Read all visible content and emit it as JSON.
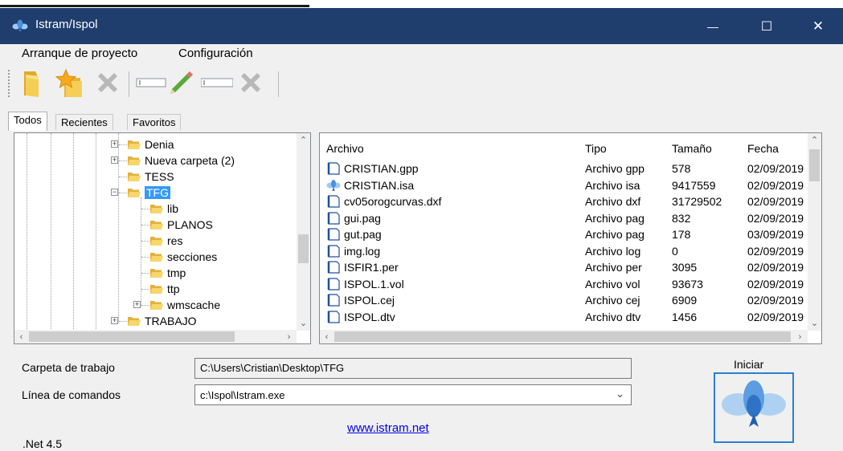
{
  "window": {
    "title": "Istram/Ispol",
    "controls": {
      "minimize": "—",
      "maximize": "☐",
      "close": "✕"
    }
  },
  "menu": [
    "Arranque de proyecto",
    "Configuración"
  ],
  "toolbar": {
    "buttons": [
      "open-folder-icon",
      "favorite-folder-icon",
      "delete-icon",
      "field-icon",
      "edit-icon",
      "field-icon",
      "delete-icon"
    ]
  },
  "tabs": [
    "Todos",
    "Recientes",
    "Favoritos"
  ],
  "tree": [
    {
      "label": "Denia",
      "expander": "+"
    },
    {
      "label": "Nueva carpeta (2)",
      "expander": "+"
    },
    {
      "label": "TESS",
      "expander": ""
    },
    {
      "label": "TFG",
      "expander": "−",
      "selected": true
    },
    {
      "label": "lib",
      "expander": ""
    },
    {
      "label": "PLANOS",
      "expander": ""
    },
    {
      "label": "res",
      "expander": ""
    },
    {
      "label": "secciones",
      "expander": ""
    },
    {
      "label": "tmp",
      "expander": ""
    },
    {
      "label": "ttp",
      "expander": ""
    },
    {
      "label": "wmscache",
      "expander": "+"
    },
    {
      "label": "TRABAJO",
      "expander": "+"
    }
  ],
  "files": {
    "columns": [
      "Archivo",
      "Tipo",
      "Tamaño",
      "Fecha"
    ],
    "rows": [
      {
        "name": "CRISTIAN.gpp",
        "type": "Archivo gpp",
        "size": "578",
        "date": "02/09/2019",
        "icon": "file-icon"
      },
      {
        "name": "CRISTIAN.isa",
        "type": "Archivo isa",
        "size": "9417559",
        "date": "02/09/2019",
        "icon": "istram-icon"
      },
      {
        "name": "cv05orogcurvas.dxf",
        "type": "Archivo dxf",
        "size": "31729502",
        "date": "02/09/2019",
        "icon": "file-icon"
      },
      {
        "name": "gui.pag",
        "type": "Archivo pag",
        "size": "832",
        "date": "02/09/2019",
        "icon": "file-icon"
      },
      {
        "name": "gut.pag",
        "type": "Archivo pag",
        "size": "178",
        "date": "03/09/2019",
        "icon": "file-icon"
      },
      {
        "name": "img.log",
        "type": "Archivo log",
        "size": "0",
        "date": "02/09/2019",
        "icon": "file-icon"
      },
      {
        "name": "ISFIR1.per",
        "type": "Archivo per",
        "size": "3095",
        "date": "02/09/2019",
        "icon": "file-icon"
      },
      {
        "name": "ISPOL.1.vol",
        "type": "Archivo vol",
        "size": "93673",
        "date": "02/09/2019",
        "icon": "file-icon"
      },
      {
        "name": "ISPOL.cej",
        "type": "Archivo cej",
        "size": "6909",
        "date": "02/09/2019",
        "icon": "file-icon"
      },
      {
        "name": "ISPOL.dtv",
        "type": "Archivo dtv",
        "size": "1456",
        "date": "02/09/2019",
        "icon": "file-icon"
      }
    ]
  },
  "work_folder": {
    "label": "Carpeta de trabajo",
    "value": "C:\\Users\\Cristian\\Desktop\\TFG"
  },
  "command_line": {
    "label": "Línea de comandos",
    "value": "c:\\Ispol\\Istram.exe"
  },
  "website": "www.istram.net",
  "start": {
    "label": "Iniciar"
  },
  "framework": ".Net 4.5",
  "colors": {
    "titlebar": "#1f3e6d",
    "selection": "#3399ff",
    "link": "#0000ee",
    "start_border": "#2a7fd4"
  }
}
